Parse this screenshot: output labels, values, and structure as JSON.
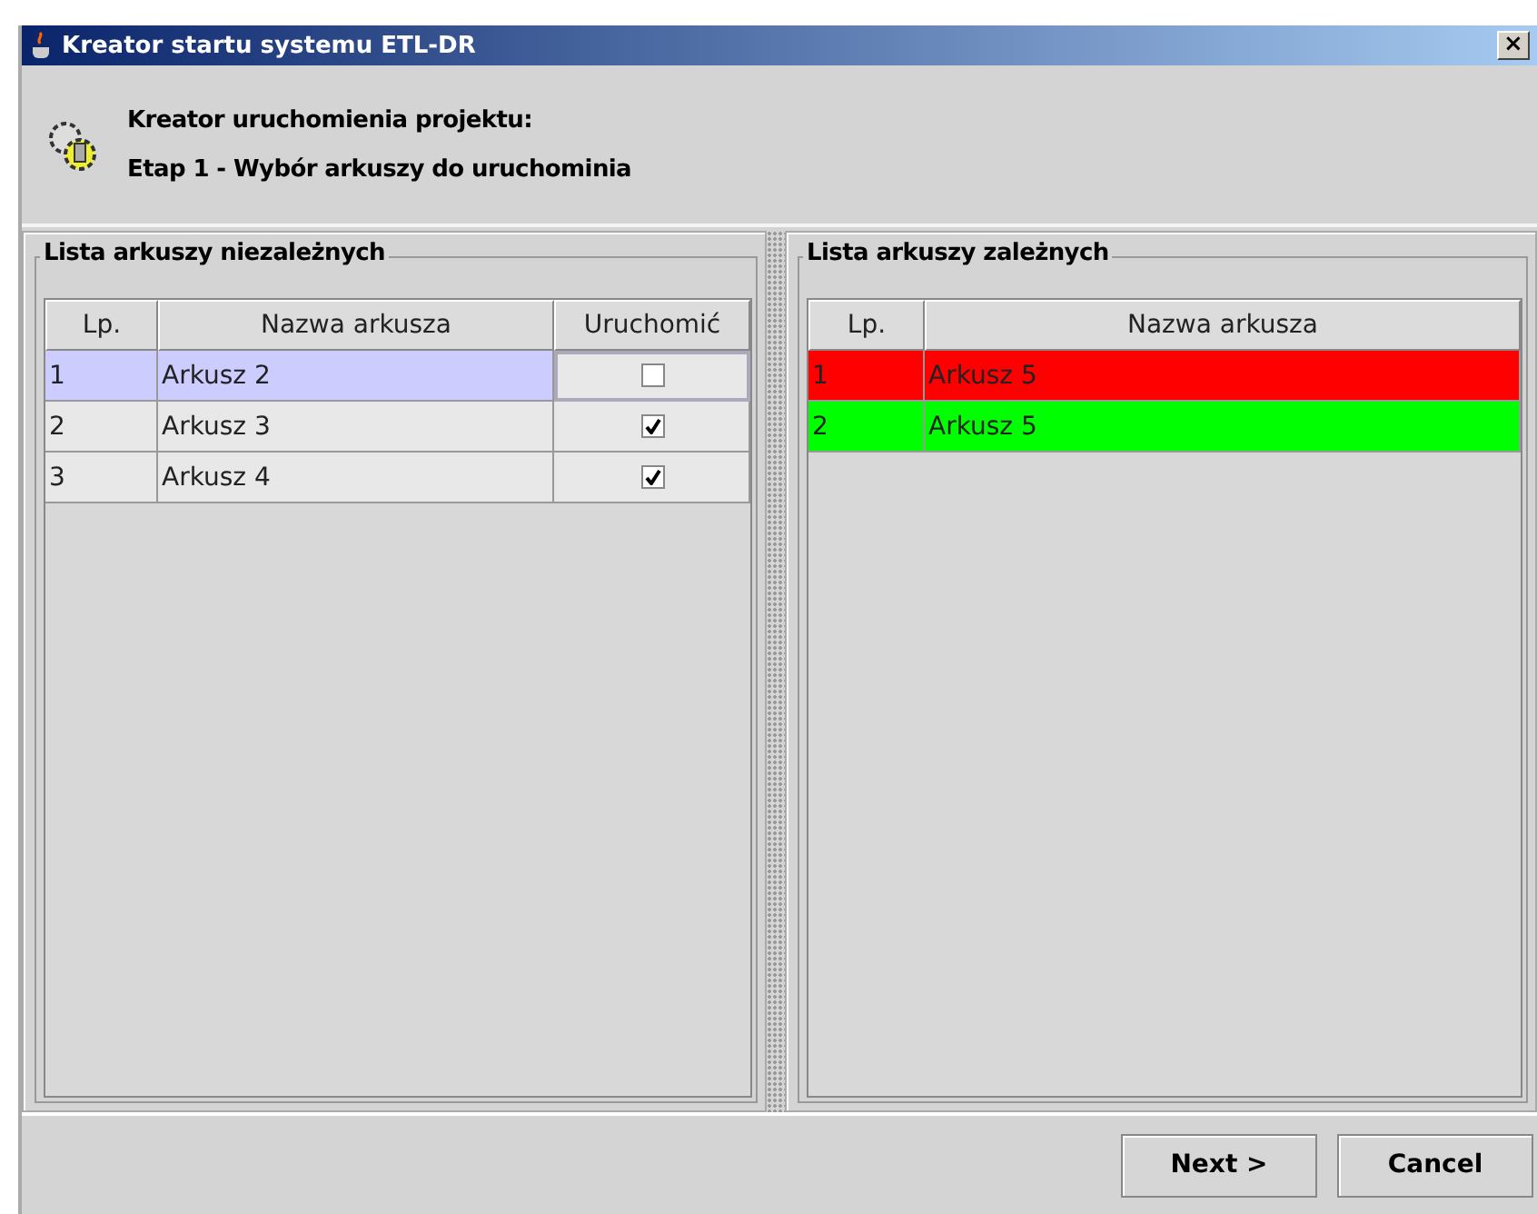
{
  "window": {
    "title": "Kreator startu systemu ETL-DR",
    "close": "×"
  },
  "header": {
    "title": "Kreator uruchomienia projektu:",
    "subtitle": "Etap 1 - Wybór arkuszy do uruchominia"
  },
  "independent": {
    "title": "Lista arkuszy niezależnych",
    "columns": [
      "Lp.",
      "Nazwa arkusza",
      "Uruchomić"
    ],
    "rows": [
      {
        "lp": "1",
        "name": "Arkusz 2",
        "checked": false,
        "selected": true
      },
      {
        "lp": "2",
        "name": "Arkusz 3",
        "checked": true,
        "selected": false
      },
      {
        "lp": "3",
        "name": "Arkusz 4",
        "checked": true,
        "selected": false
      }
    ]
  },
  "dependent": {
    "title": "Lista arkuszy zależnych",
    "columns": [
      "Lp.",
      "Nazwa arkusza"
    ],
    "rows": [
      {
        "lp": "1",
        "name": "Arkusz 5",
        "color": "#ff0000"
      },
      {
        "lp": "2",
        "name": "Arkusz 5",
        "color": "#00ff00"
      }
    ]
  },
  "buttons": [
    "Next >",
    "Cancel"
  ]
}
